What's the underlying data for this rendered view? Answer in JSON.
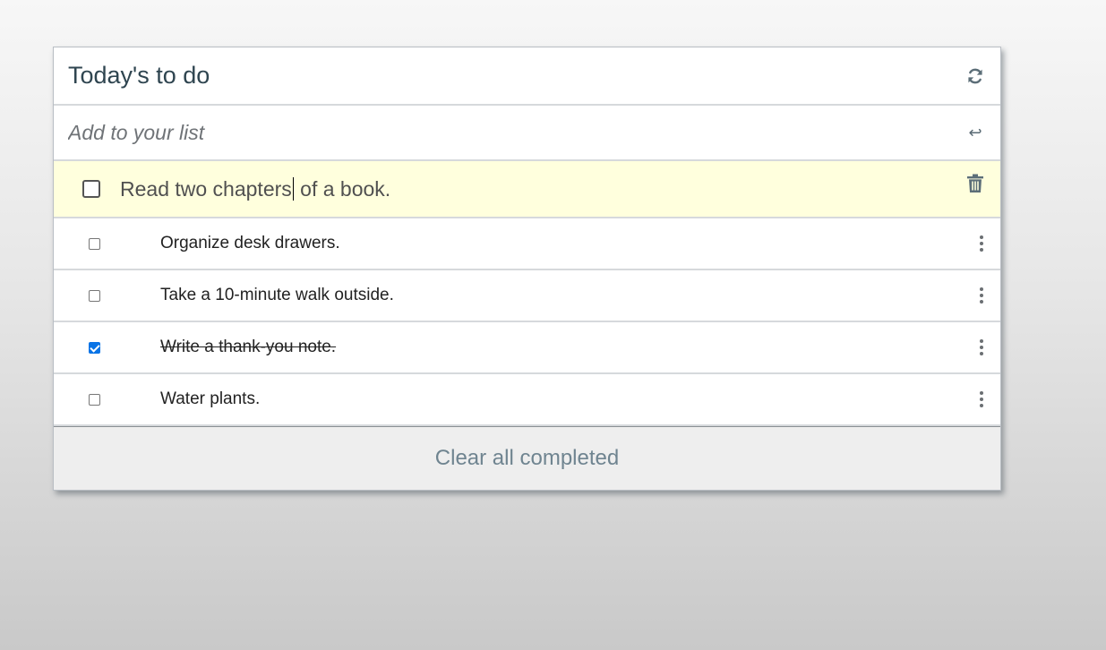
{
  "header": {
    "title": "Today's to do",
    "refresh_icon": "refresh-icon"
  },
  "add_input": {
    "placeholder": "Add to your list",
    "value": "",
    "enter_icon": "↩"
  },
  "editing_item": {
    "text_before_caret": "Read two chapters",
    "text_after_caret": " of a book.",
    "checked": false,
    "delete_icon": "trash-icon"
  },
  "todos": [
    {
      "text": "Organize desk drawers.",
      "checked": false
    },
    {
      "text": "Take a 10-minute walk outside.",
      "checked": false
    },
    {
      "text": "Write a thank-you note.",
      "checked": true
    },
    {
      "text": "Water plants.",
      "checked": false
    }
  ],
  "footer": {
    "clear_label": "Clear all completed"
  },
  "colors": {
    "editing_background": "#ffffdd",
    "checkbox_accent": "#0a74e6",
    "title_text": "#2f4550"
  }
}
